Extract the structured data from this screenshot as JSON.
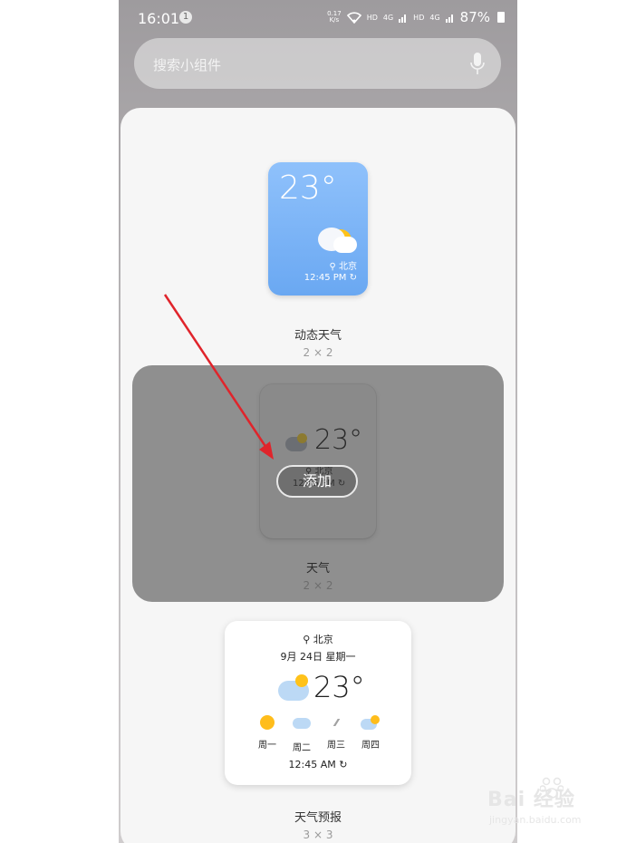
{
  "status_bar": {
    "time": "16:01",
    "notification_count": "1",
    "net_speed_value": "0.17",
    "net_speed_unit": "K/s",
    "hd1": "HD",
    "hd2": "HD",
    "signal1": "4G",
    "signal2": "4G",
    "battery": "87%"
  },
  "search": {
    "placeholder": "搜索小组件"
  },
  "widgets": [
    {
      "name": "动态天气",
      "size": "2 × 2",
      "temperature": "23°",
      "location": "北京",
      "time": "12:45 PM"
    },
    {
      "name": "天气",
      "size": "2 × 2",
      "temperature": "23°",
      "location": "北京",
      "time": "12:45 PM",
      "add_label": "添加"
    },
    {
      "name": "天气预报",
      "size": "3 × 3",
      "location": "北京",
      "date": "9月 24日 星期一",
      "temperature": "23°",
      "days": [
        "周一",
        "周二",
        "周三",
        "周四"
      ],
      "time": "12:45 AM"
    }
  ],
  "watermark": {
    "logo_text": "Bai  经验",
    "sub_text": "jingyan.baidu.com"
  },
  "colors": {
    "arrow": "#e0242b",
    "selected_panel": "#8f8f8f",
    "widget_blue": "#7ab3f6",
    "sun_yellow": "#ffc21a"
  }
}
